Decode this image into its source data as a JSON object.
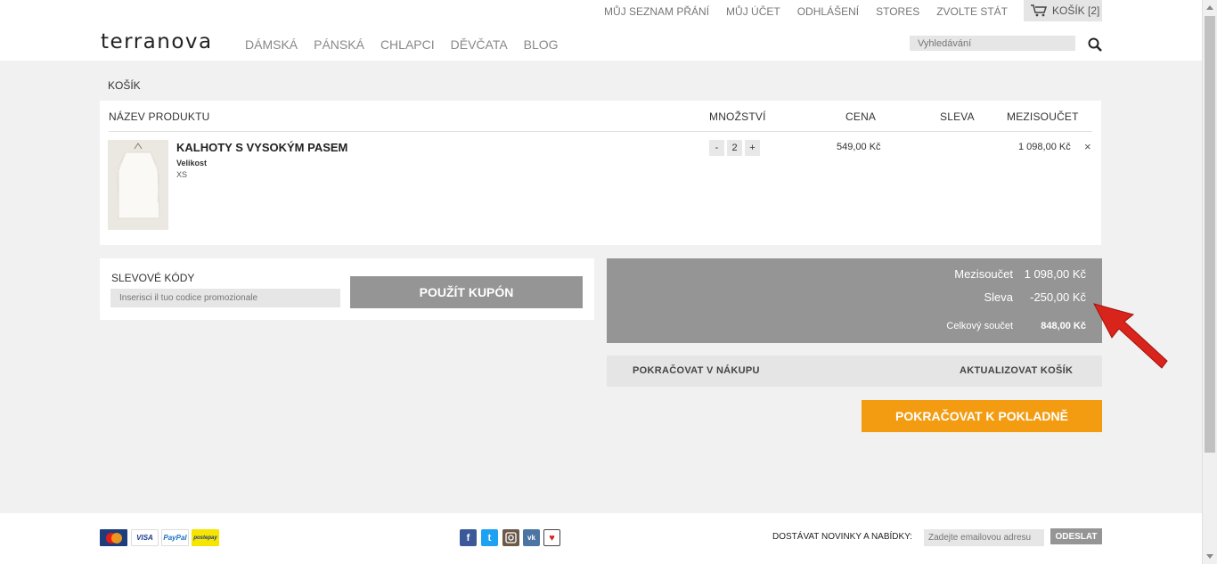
{
  "header": {
    "logo": "Terranova",
    "top_links": [
      "MŮJ SEZNAM PŘÁNÍ",
      "MŮJ ÚČET",
      "ODHLÁŠENÍ",
      "STORES",
      "ZVOLTE STÁT"
    ],
    "cart_label": "KOŠÍK [2]",
    "nav": [
      "DÁMSKÁ",
      "PÁNSKÁ",
      "CHLAPCI",
      "DĚVČATA",
      "BLOG"
    ],
    "search_placeholder": "Vyhledávání"
  },
  "breadcrumb": "KOŠÍK",
  "cart": {
    "headers": {
      "product": "NÁZEV PRODUKTU",
      "qty": "MNOŽSTVÍ",
      "price": "CENA",
      "discount": "SLEVA",
      "subtotal": "MEZISOUČET"
    },
    "items": [
      {
        "name": "KALHOTY S VYSOKÝM PASEM",
        "attr_label": "Velikost",
        "attr_value": "XS",
        "qty_minus": "-",
        "qty": "2",
        "qty_plus": "+",
        "price": "549,00 Kč",
        "discount": "",
        "subtotal": "1 098,00 Kč",
        "remove": "×"
      }
    ]
  },
  "coupon": {
    "label": "SLEVOVÉ KÓDY",
    "placeholder": "Inserisci il tuo codice promozionale",
    "button": "POUŽÍT KUPÓN"
  },
  "totals": {
    "subtotal_label": "Mezisoučet",
    "subtotal_value": "1 098,00 Kč",
    "discount_label": "Sleva",
    "discount_value": "-250,00 Kč",
    "total_label": "Celkový součet",
    "total_value": "848,00 Kč"
  },
  "actions": {
    "continue": "POKRAČOVAT V NÁKUPU",
    "update": "AKTUALIZOVAT KOŠÍK",
    "checkout": "POKRAČOVAT K POKLADNĚ"
  },
  "footer": {
    "payments": [
      "MasterCard",
      "VISA",
      "PayPal",
      "postepay"
    ],
    "social": [
      "facebook-icon",
      "twitter-icon",
      "instagram-icon",
      "vk-icon",
      "heart-icon"
    ],
    "newsletter_label": "DOSTÁVAT NOVINKY A NABÍDKY:",
    "email_placeholder": "Zadejte emailovou adresu",
    "send_button": "ODESLAT"
  },
  "colors": {
    "checkout": "#f39c12",
    "totals_bg": "#959595",
    "page_bg": "#f1f1f1",
    "arrow": "#d9241b"
  }
}
